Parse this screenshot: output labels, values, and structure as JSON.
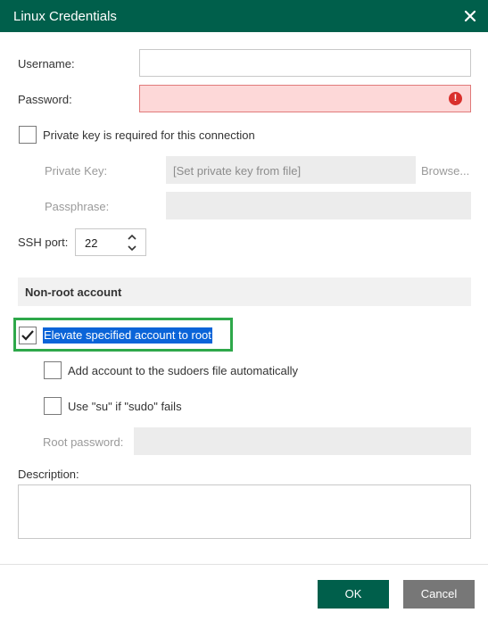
{
  "window": {
    "title": "Linux Credentials",
    "close_icon": "close-icon"
  },
  "form": {
    "username_label": "Username:",
    "username_value": "",
    "password_label": "Password:",
    "password_value": "",
    "password_error_icon": "!",
    "private_key_checkbox_label": "Private key is required for this connection",
    "private_key_checked": false,
    "private_key_label": "Private Key:",
    "private_key_placeholder": "[Set private key from file]",
    "browse_label": "Browse...",
    "passphrase_label": "Passphrase:",
    "ssh_port_label": "SSH port:",
    "ssh_port_value": "22"
  },
  "non_root": {
    "section_title": "Non-root account",
    "elevate_label": "Elevate specified account to root",
    "elevate_checked": true,
    "sudoers_label": "Add account to the sudoers file automatically",
    "sudoers_checked": false,
    "su_label": "Use \"su\" if \"sudo\" fails",
    "su_checked": false,
    "root_password_label": "Root password:"
  },
  "description": {
    "label": "Description:",
    "value": ""
  },
  "buttons": {
    "ok": "OK",
    "cancel": "Cancel"
  },
  "colors": {
    "header": "#005f4b",
    "highlight": "#2ea84a",
    "error_fill": "#fdd8d8",
    "error_icon": "#d9302c",
    "selection": "#0a64d8"
  }
}
